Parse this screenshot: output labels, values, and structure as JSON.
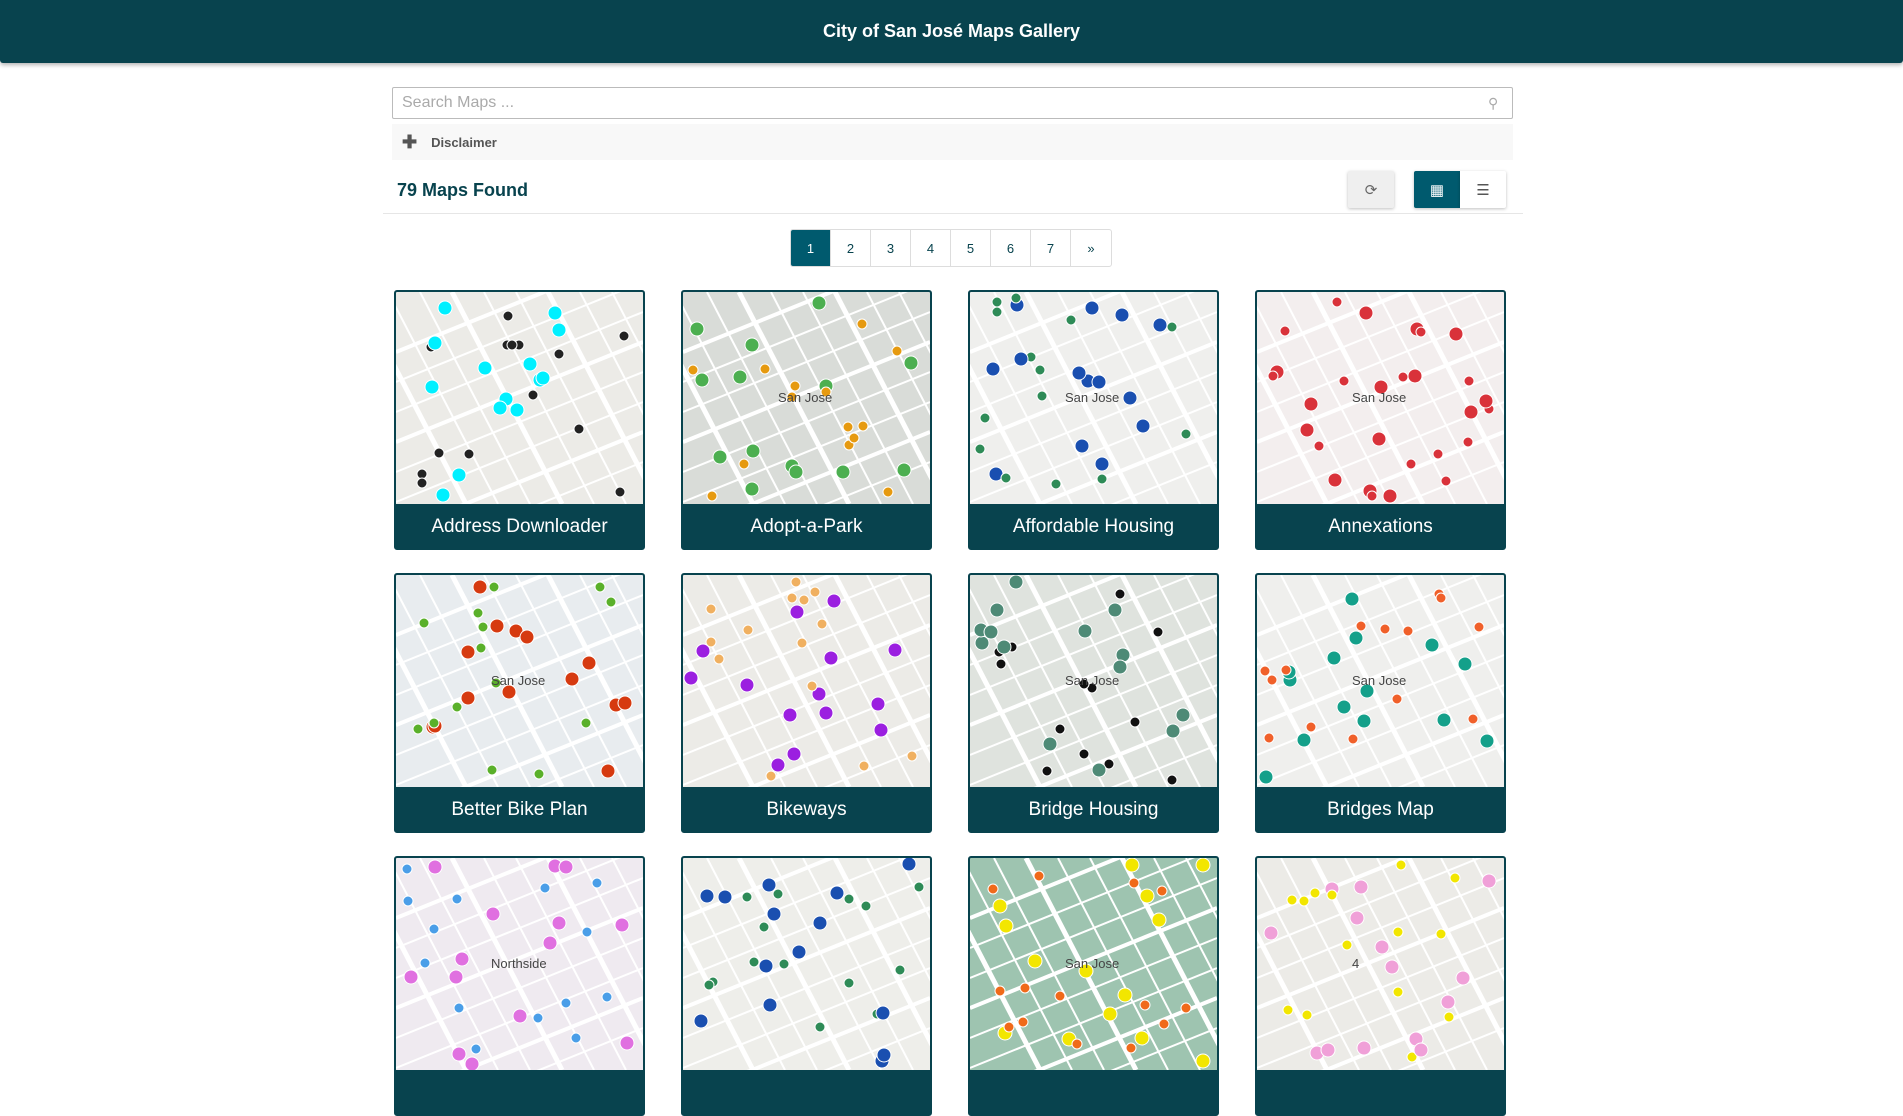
{
  "header": {
    "title": "City of San José Maps Gallery"
  },
  "search": {
    "placeholder": "Search Maps ...",
    "value": "",
    "icon": "search-icon"
  },
  "disclaimer": {
    "label": "Disclaimer",
    "icon": "plus-icon"
  },
  "results": {
    "count_label": "79 Maps Found"
  },
  "toolbar": {
    "refresh_icon": "refresh-icon",
    "grid_icon": "grid-view-icon",
    "list_icon": "list-view-icon",
    "active_view": "grid"
  },
  "pagination": {
    "pages": [
      "1",
      "2",
      "3",
      "4",
      "5",
      "6",
      "7",
      "»"
    ],
    "active": "1"
  },
  "colors": {
    "header": "#08434e",
    "accent": "#005a6e"
  },
  "maps": [
    {
      "title": "Address Downloader",
      "bg": "#ecebe7",
      "markers": [
        "#00f0ff",
        "#222222"
      ],
      "label": ""
    },
    {
      "title": "Adopt-a-Park",
      "bg": "#d9dcd8",
      "markers": [
        "#4caf50",
        "#e69a10"
      ],
      "label": "San Jose"
    },
    {
      "title": "Affordable Housing",
      "bg": "#efefed",
      "markers": [
        "#1a4fb0",
        "#2e8b57"
      ],
      "label": "San Jose"
    },
    {
      "title": "Annexations",
      "bg": "#f3eeee",
      "markers": [
        "#d9323a",
        "#d9323a"
      ],
      "label": "San Jose"
    },
    {
      "title": "Better Bike Plan",
      "bg": "#e8ecef",
      "markers": [
        "#d63a10",
        "#5ab02a"
      ],
      "label": "San Jose"
    },
    {
      "title": "Bikeways",
      "bg": "#ecebe7",
      "markers": [
        "#9b1fe0",
        "#f0b060"
      ],
      "label": ""
    },
    {
      "title": "Bridge Housing",
      "bg": "#dfe3de",
      "markers": [
        "#4e8a76",
        "#111111"
      ],
      "label": "San Jose"
    },
    {
      "title": "Bridges Map",
      "bg": "#efefed",
      "markers": [
        "#14a08a",
        "#f0602a"
      ],
      "label": "San Jose"
    },
    {
      "title": "",
      "bg": "#efeaf0",
      "markers": [
        "#e070e0",
        "#4a9ee8"
      ],
      "label": "Northside"
    },
    {
      "title": "",
      "bg": "#eeeeea",
      "markers": [
        "#1a4fb0",
        "#2e8b57"
      ],
      "label": ""
    },
    {
      "title": "",
      "bg": "#9ec4b0",
      "markers": [
        "#f2e600",
        "#f06a1a"
      ],
      "label": "San Jose"
    },
    {
      "title": "",
      "bg": "#ecebe7",
      "markers": [
        "#f0a0d8",
        "#f2e600"
      ],
      "label": "4"
    }
  ]
}
